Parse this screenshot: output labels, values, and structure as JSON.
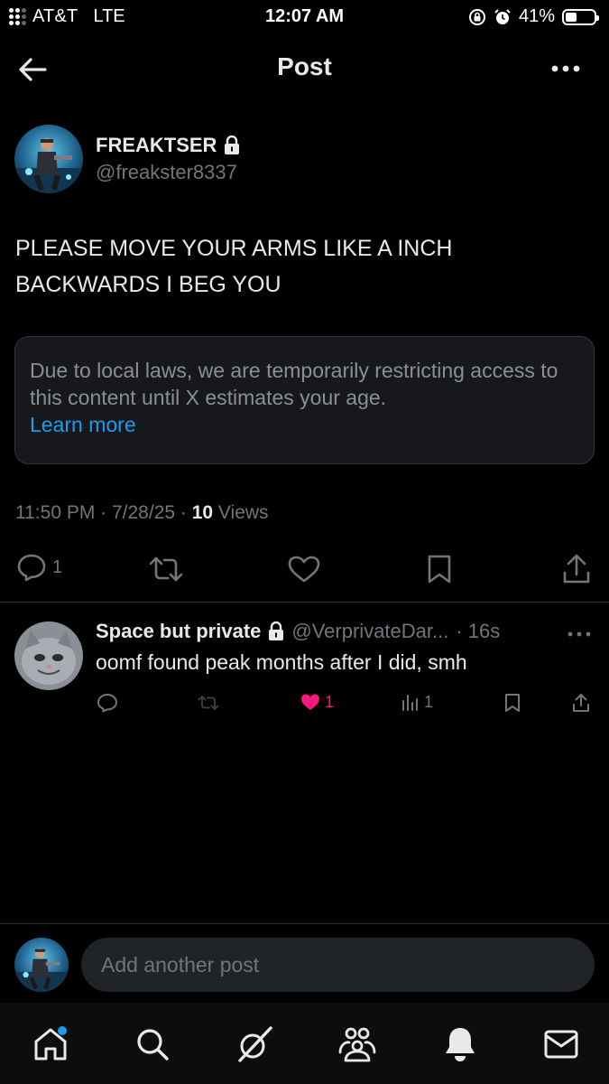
{
  "status_bar": {
    "carrier": "AT&T",
    "network": "LTE",
    "time": "12:07 AM",
    "battery_percent": "41%",
    "battery_level": 0.41,
    "icons": [
      "signal-dots-icon",
      "orientation-lock-icon",
      "alarm-icon",
      "battery-icon"
    ]
  },
  "header": {
    "title": "Post",
    "back_icon": "arrow-left-icon",
    "more_icon": "more-horizontal-icon"
  },
  "post": {
    "author_name": "FREAKTSER",
    "author_handle": "@freakster8337",
    "protected_icon": "lock-icon",
    "text": "PLEASE MOVE YOUR ARMS LIKE A INCH BACKWARDS I BEG YOU",
    "notice": {
      "text": "Due to local laws, we are temporarily restricting access to this content until X estimates your age.",
      "link": "Learn more"
    },
    "meta": {
      "time_date": "11:50 PM · 7/28/25 · ",
      "views_count": "10",
      "views_label": " Views"
    },
    "actions": {
      "reply_count": "1",
      "icons": [
        "reply-icon",
        "repost-icon",
        "like-icon",
        "bookmark-icon",
        "share-icon"
      ]
    }
  },
  "reply": {
    "author_name": "Space but private",
    "author_handle": "@VerprivateDar...",
    "age": "· 16s",
    "text": "oomf found peak months after I did, smh",
    "like_count": "1",
    "views_count": "1",
    "liked": true
  },
  "composer": {
    "placeholder": "Add another post"
  },
  "tab_bar": {
    "items": [
      "home-icon",
      "search-icon",
      "grok-icon",
      "communities-icon",
      "notifications-icon",
      "messages-icon"
    ],
    "active": "home-icon"
  },
  "colors": {
    "background": "#000000",
    "text_primary": "#e7e9ea",
    "text_secondary": "#71767b",
    "link": "#1d9bf0",
    "like": "#f91880"
  }
}
